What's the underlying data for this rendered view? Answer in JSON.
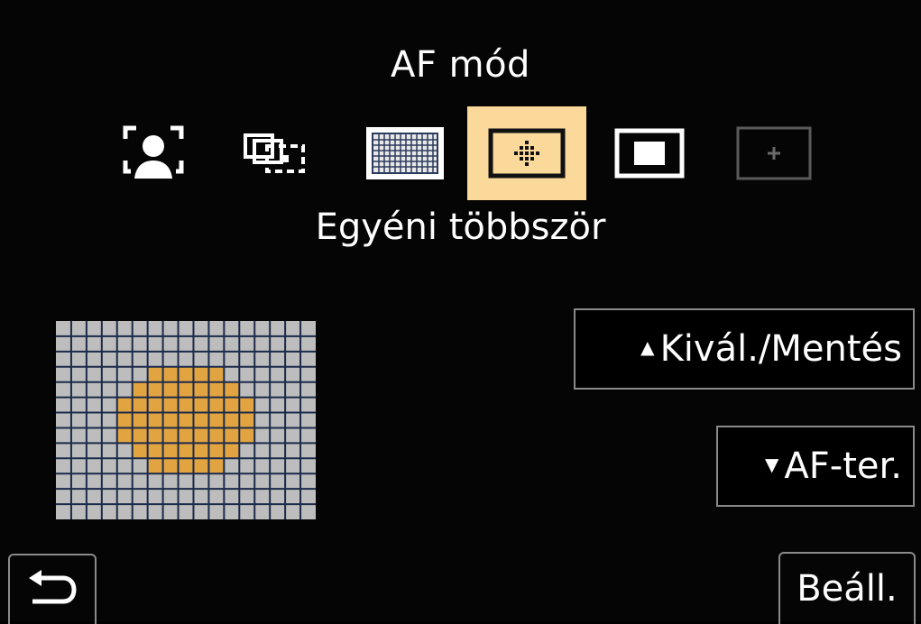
{
  "header": {
    "title": "AF mód"
  },
  "af_modes": {
    "items": [
      {
        "icon": "face-eye-detection-icon",
        "selected": false,
        "enabled": true
      },
      {
        "icon": "tracking-icon",
        "selected": false,
        "enabled": true
      },
      {
        "icon": "49-area-icon",
        "selected": false,
        "enabled": true
      },
      {
        "icon": "custom-multi-icon",
        "selected": true,
        "enabled": true
      },
      {
        "icon": "1-area-icon",
        "selected": false,
        "enabled": true
      },
      {
        "icon": "pinpoint-icon",
        "selected": false,
        "enabled": false
      }
    ],
    "selected_label": "Egyéni többször"
  },
  "grid": {
    "columns": 17,
    "rows": 13,
    "base_color": "#bdbdbd",
    "line_color": "#1b2a4a",
    "active_color": "#e2a441"
  },
  "buttons": {
    "select_save": "Kivál./Mentés",
    "af_area": "AF-ter.",
    "set": "Beáll."
  },
  "colors": {
    "background": "#050505",
    "selected_bg": "#fbd99a",
    "border": "#8a8a8a"
  }
}
